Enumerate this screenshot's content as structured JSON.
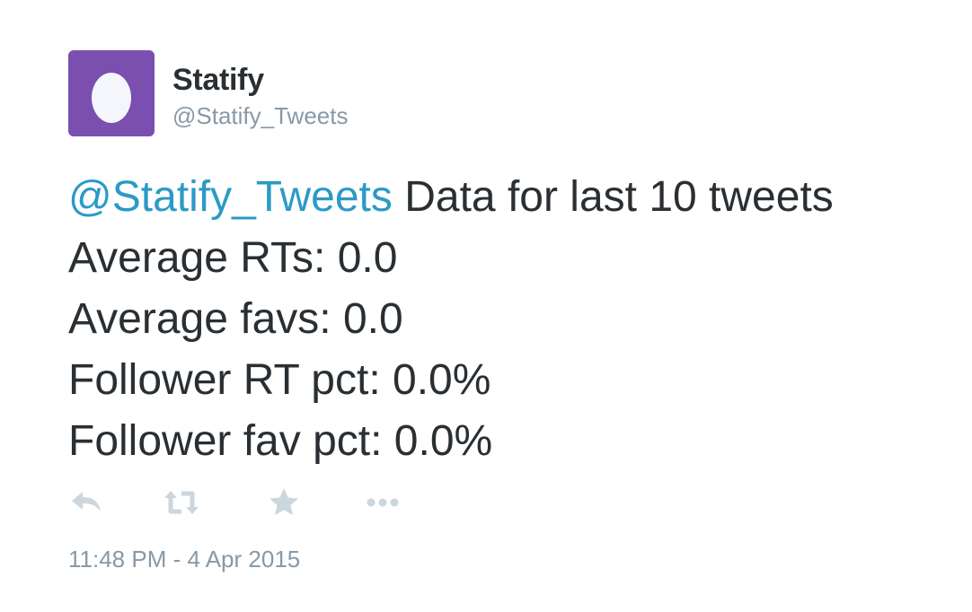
{
  "user": {
    "display_name": "Statify",
    "screen_name": "@Statify_Tweets",
    "avatar_icon": "egg-avatar-icon",
    "avatar_bg_color": "#7a4fb0"
  },
  "tweet": {
    "mention": "@Statify_Tweets",
    "lines": [
      " Data for last 10 tweets",
      "Average RTs: 0.0",
      "Average favs: 0.0",
      "Follower RT pct: 0.0%",
      "Follower fav pct: 0.0%"
    ],
    "mention_color": "#2b9ac6",
    "text_color": "#292f33"
  },
  "actions": {
    "reply_icon": "reply-icon",
    "retweet_icon": "retweet-icon",
    "favorite_icon": "star-icon",
    "more_icon": "more-dots-icon",
    "icon_color": "#ccd6dd"
  },
  "timestamp": "11:48 PM - 4 Apr 2015"
}
